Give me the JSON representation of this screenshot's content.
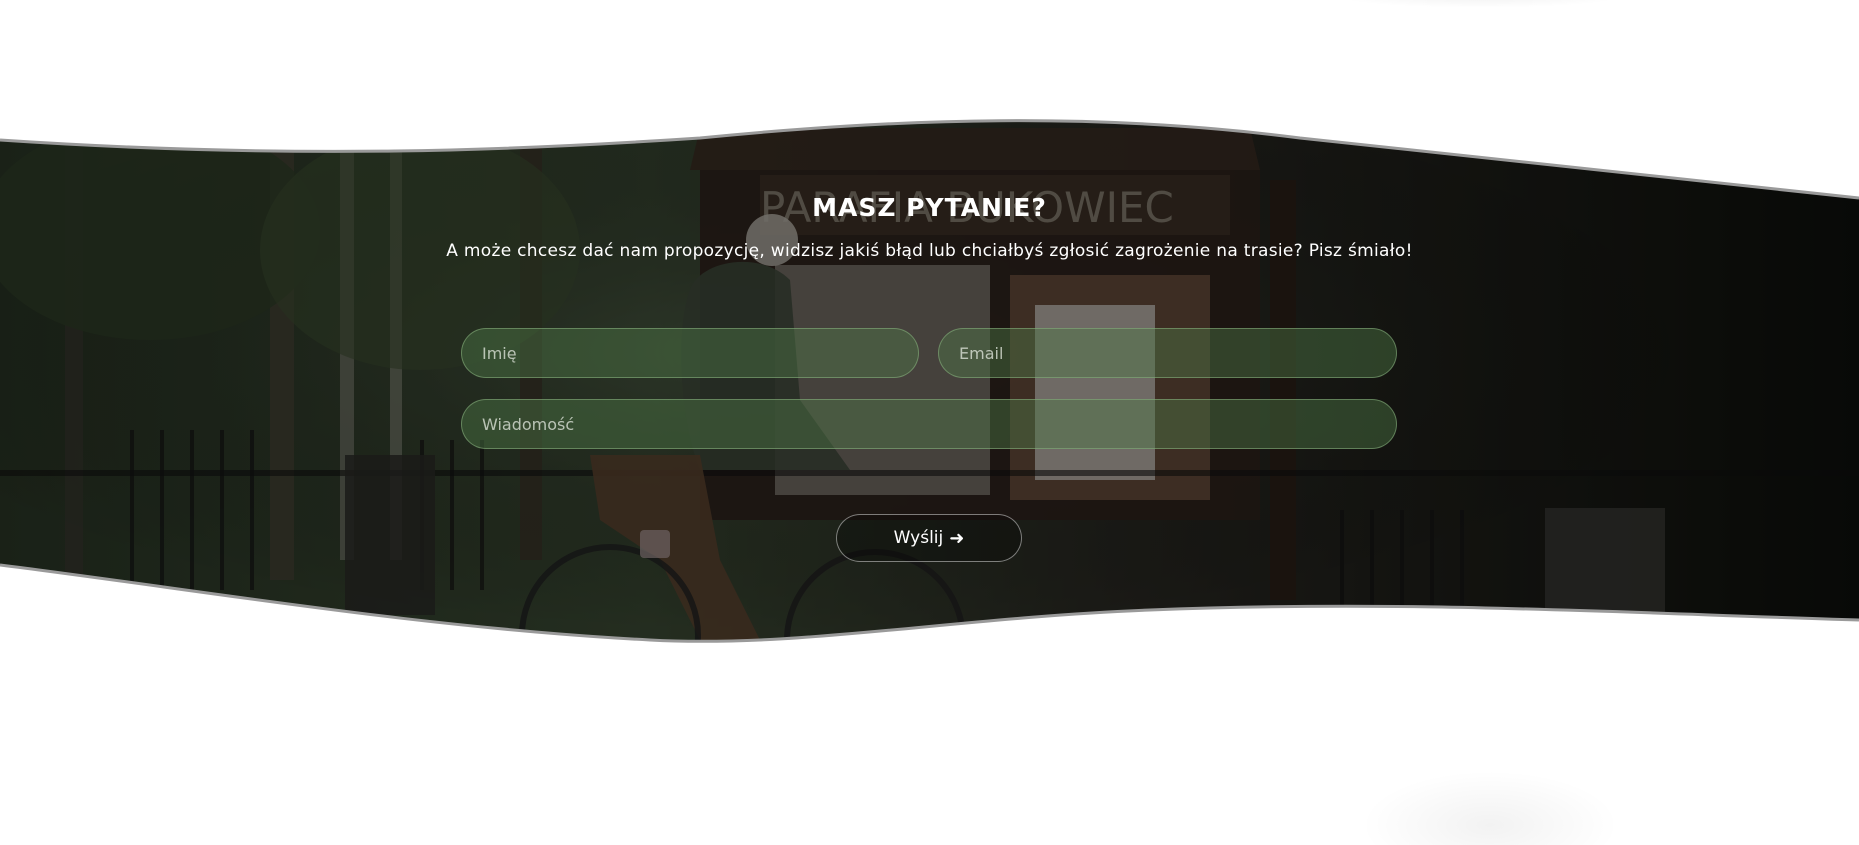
{
  "contact": {
    "heading": "MASZ PYTANIE?",
    "subtitle": "A może chcesz dać nam propozycję, widzisz jakiś błąd lub chciałbyś zgłosić zagrożenie na trasie? Pisz śmiało!",
    "background_image": {
      "description_icon": "photo-cyclist-parish-notice-board",
      "sign_text": "PARAFIA BUKOWIEC"
    },
    "form": {
      "name_placeholder": "Imię",
      "name_value": "",
      "email_placeholder": "Email",
      "email_value": "",
      "message_placeholder": "Wiadomość",
      "message_value": "",
      "submit_label": "Wyślij",
      "submit_icon": "arrow-right-icon",
      "submit_arrow": "➜"
    }
  },
  "colors": {
    "page_background": "#ffffff",
    "overlay_tint": "#1a2416",
    "field_fill": "#4e7848",
    "field_border": "#8cb482",
    "text": "#ffffff",
    "wave_edge": "#9a9a9a"
  }
}
